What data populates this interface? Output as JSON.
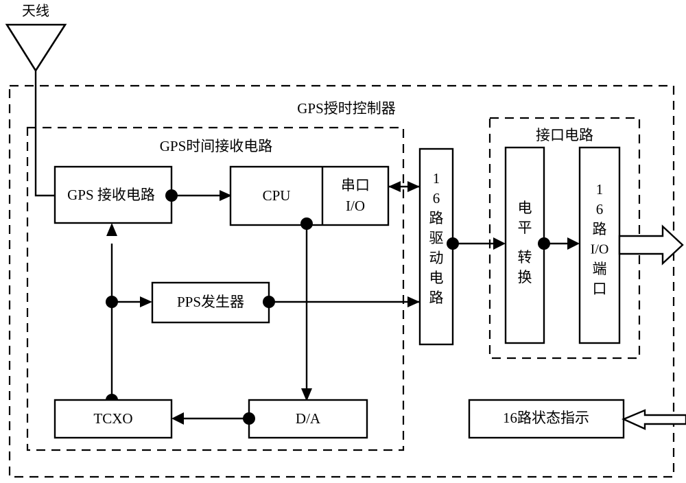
{
  "diagram": {
    "title_hidden": "GPS timing controller block diagram",
    "antenna": {
      "label": "天线",
      "icon": "antenna-triangle-icon"
    },
    "groups": [
      {
        "id": "outer",
        "label": "GPS授时控制器",
        "style": "dashed"
      },
      {
        "id": "receiver",
        "label": "GPS时间接收电路",
        "style": "dashed"
      },
      {
        "id": "interface",
        "label": "接口电路",
        "style": "dashed"
      }
    ],
    "blocks": [
      {
        "id": "gps-rx",
        "label": "GPS 接收电路",
        "orientation": "horizontal"
      },
      {
        "id": "cpu",
        "label": "CPU",
        "orientation": "horizontal"
      },
      {
        "id": "serial-io",
        "label": "串口",
        "label2": "I/O",
        "orientation": "horizontal"
      },
      {
        "id": "pps",
        "label": "PPS发生器",
        "orientation": "horizontal"
      },
      {
        "id": "tcxo",
        "label": "TCXO",
        "orientation": "horizontal"
      },
      {
        "id": "da",
        "label": "D/A",
        "orientation": "horizontal"
      },
      {
        "id": "driver16",
        "label": "16路驱动电路",
        "orientation": "vertical"
      },
      {
        "id": "level-conv",
        "label": "电平转换",
        "orientation": "vertical"
      },
      {
        "id": "io-port16",
        "label": "16路I/O端口",
        "orientation": "vertical"
      },
      {
        "id": "status16",
        "label": "16路状态指示",
        "orientation": "horizontal"
      }
    ],
    "vertical_text": {
      "driver16": [
        "1",
        "6",
        "路",
        "驱",
        "动",
        "电",
        "路"
      ],
      "level_conv": [
        "电",
        "平",
        "转",
        "换"
      ],
      "io_port16": [
        "1",
        "6",
        "路",
        "I/O",
        "端",
        "口"
      ]
    },
    "colors": {
      "stroke": "#000000",
      "fill": "#ffffff",
      "background": "#ffffff"
    }
  }
}
